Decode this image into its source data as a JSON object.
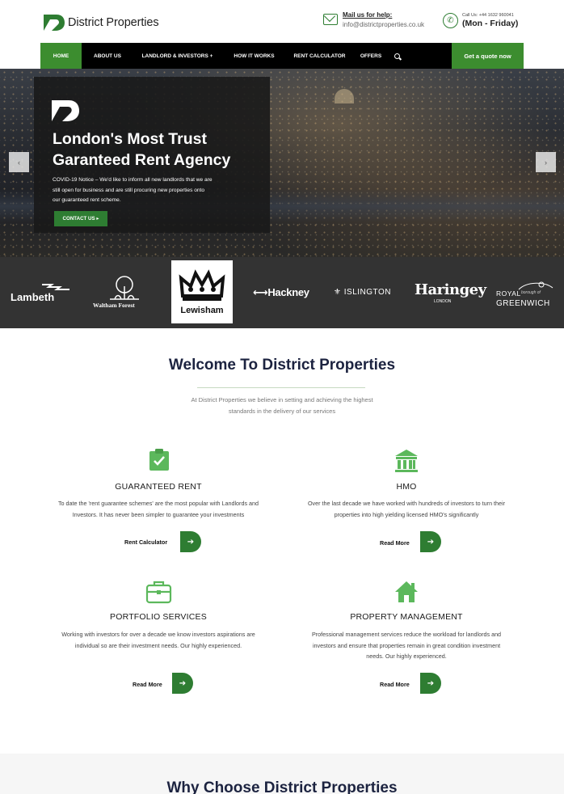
{
  "header": {
    "logo_text": "District Properties",
    "mail_title": "Mail us for help:",
    "mail_address": "info@districtproperties.co.uk",
    "phone_line": "Call Us: +44 1632 960041",
    "hours": "(Mon - Friday)",
    "icons": {
      "mail": "envelope-icon",
      "phone": "phone-icon"
    }
  },
  "nav": {
    "items": [
      "HOME",
      "ABOUT US",
      "LANDLORD & INVESTORS +",
      "HOW IT WORKS",
      "RENT CALCULATOR",
      "OFFERS"
    ],
    "active": "HOME",
    "search_icon": "search-icon",
    "quote_button": "Get a quote now"
  },
  "hero": {
    "title_line1": "London's Most Trust",
    "title_line2": "Garanteed Rent Agency",
    "notice_line1": "COVID-19 Notice – We'd like to inform all new landlords that we are",
    "notice_line2": "still open for business and are still procuring new properties onto",
    "notice_line3": "our guaranteed rent scheme.",
    "contact_button": "CONTACT US ▸",
    "prev": "‹",
    "next": "›"
  },
  "boroughs": {
    "lambeth": "Lambeth",
    "waltham": "Waltham Forest",
    "lewisham": "Lewisham",
    "hackney": "⟷Hackney",
    "islington": "⚜ ISLINGTON",
    "haringey": "Haringey",
    "haringey_sub": "LONDON",
    "royal": "ROYAL",
    "royal_sub": "borough of",
    "greenwich": "GREENWICH"
  },
  "welcome": {
    "title": "Welcome To District Properties",
    "subtitle_line1": "At District Properties we believe in setting and achieving the highest",
    "subtitle_line2": "standards in the delivery of our services"
  },
  "features": [
    {
      "icon": "clipboard-check-icon",
      "title": "GUARANTEED RENT",
      "desc_line1": "To date the 'rent guarantee schemes' are the most popular with Landlords and",
      "desc_line2": "Investors. It has never been simpler to guarantee your investments",
      "desc_line3": "",
      "link": "Rent Calculator"
    },
    {
      "icon": "bank-building-icon",
      "title": "HMO",
      "desc_line1": "Over the last decade we have worked with hundreds of investors to turn their",
      "desc_line2": "properties into high yielding licensed HMO's significantly",
      "desc_line3": "",
      "link": "Read More"
    },
    {
      "icon": "briefcase-icon",
      "title": "PORTFOLIO SERVICES",
      "desc_line1": "Working with investors for over a decade we know investors aspirations are",
      "desc_line2": "individual so are their investment needs. Our highly experienced.",
      "desc_line3": "",
      "link": "Read More"
    },
    {
      "icon": "house-icon",
      "title": "PROPERTY MANAGEMENT",
      "desc_line1": "Professional management services reduce the workload for landlords and",
      "desc_line2": "investors and ensure that properties remain in great condition investment",
      "desc_line3": "needs. Our highly experienced.",
      "link": "Read More"
    }
  ],
  "why": {
    "title": "Why Choose District Properties"
  },
  "colors": {
    "brand_green": "#2e7d32",
    "nav_active": "#3c8d2f",
    "title_navy": "#1c2340"
  }
}
